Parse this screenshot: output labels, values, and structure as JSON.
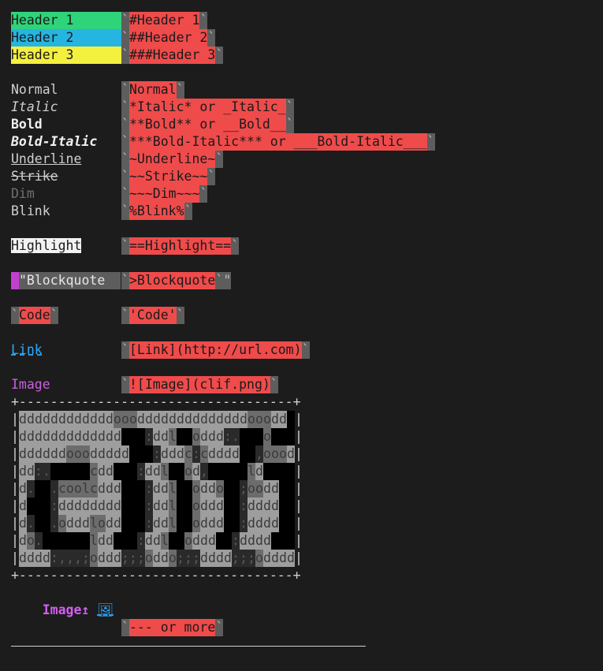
{
  "rows": [
    {
      "left": "Header 1",
      "left_style": "h1",
      "right": "#Header 1"
    },
    {
      "left": "Header 2",
      "left_style": "h2",
      "right": "##Header 2"
    },
    {
      "left": "Header 3",
      "left_style": "h3",
      "right": "###Header 3"
    },
    {
      "blank": true
    },
    {
      "left": "Normal",
      "left_style": "normal",
      "right": "Normal"
    },
    {
      "left": "Italic",
      "left_style": "italic",
      "right": "*Italic* or _Italic_"
    },
    {
      "left": "Bold",
      "left_style": "bold",
      "right": "**Bold** or __Bold__"
    },
    {
      "left": "Bold-Italic",
      "left_style": "bolditalic",
      "right": "***Bold-Italic*** or ___Bold-Italic___"
    },
    {
      "left": "Underline",
      "left_style": "underline",
      "right": "~Underline~"
    },
    {
      "left": "Strike",
      "left_style": "strike",
      "right": "~~Strike~~"
    },
    {
      "left": "Dim",
      "left_style": "dim",
      "right": "~~~Dim~~~"
    },
    {
      "left": "Blink",
      "left_style": "normal",
      "right": "%Blink%"
    },
    {
      "blank": true
    },
    {
      "left": "Highlight",
      "left_style": "highlight",
      "right": "==Highlight=="
    },
    {
      "blank": true
    },
    {
      "left": "\"Blockquote  ",
      "left_style": "blockquote",
      "right": ">Blockquote",
      "trailing": "\""
    },
    {
      "blank": true
    },
    {
      "left": "Code",
      "left_style": "code",
      "right": "'Code'"
    },
    {
      "blank": true
    },
    {
      "left": "Link",
      "left_style": "link",
      "right": "[Link](http://url.com)"
    },
    {
      "blank": true
    },
    {
      "left": "Image",
      "left_style": "image",
      "right": "![Image](clif.png)"
    }
  ],
  "frame_top": "+-----------------------------------+",
  "frame_bottom": "+-----------------------------------+",
  "art": [
    "ddddddddddddoooddddddddddddddooodd",
    "ddddddddddddd   :ddl  oddd:.   o",
    "ddddddoooddddd   :dddc:cdddd  ,oood",
    "dd:.     cdd   :ddl  od,     ld",
    "d.  .coolcddd   :ddl  oddo  ;oodd",
    "d   :dddddddd   :ddl  oddd  :dddd",
    "d.  .odddlodd   :ddl  oddd  :dddd",
    "do.      ldd   :ddl  oddd  :dddd",
    "dddd:,,,;oddd;;;oddo;;;dddd;;;odddd"
  ],
  "image_link_label": "Image↥",
  "image_link_icon": "🖼",
  "more": "--- or more",
  "colors": {
    "header1": "#2fd37a",
    "header2": "#26b4e0",
    "header3": "#f4f03e",
    "code_red": "#ef4b4b",
    "backtick_gray": "#5d5d5d",
    "blockquote_bar": "#c23fd0",
    "link": "#2ea8ff",
    "image": "#c960dd",
    "background": "#1c1c1c"
  }
}
